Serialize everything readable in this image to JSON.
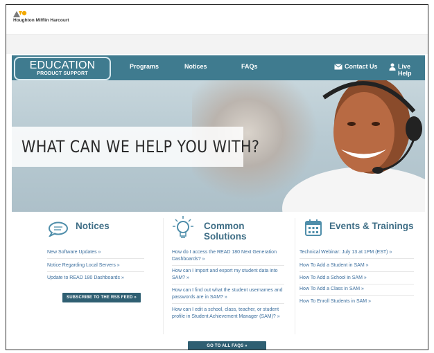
{
  "header": {
    "company": "Houghton Mifflin Harcourt"
  },
  "nav": {
    "brand_title": "EDUCATION",
    "brand_sub": "PRODUCT SUPPORT",
    "items": [
      "Programs",
      "Notices",
      "FAQs"
    ],
    "contact_label": "Contact Us",
    "live_help_label": "Live Help"
  },
  "hero": {
    "headline": "WHAT CAN WE HELP YOU WITH?"
  },
  "notices": {
    "title": "Notices",
    "links": [
      "New Software Updates »",
      "Notice Regarding Local Servers »",
      "Update to READ 180 Dashboards »"
    ],
    "button_label": "SUBSCRIBE TO THE RSS FEED »"
  },
  "solutions": {
    "title": "Common Solutions",
    "links": [
      "How do I access the READ 180 Next Generation Dashboards? »",
      "How can I import and export my student data into SAM? »",
      "How can I find out what the student usernames and passwords are in SAM? »",
      "How can I edit a school, class, teacher, or student profile in Student Achievement Manager (SAM)? »"
    ],
    "button_label": "GO TO ALL FAQS »"
  },
  "events": {
    "title": "Events & Trainings",
    "links": [
      "Technical Webinar: July 13 at 1PM (EST) »",
      "How To Add a Student in SAM »",
      "How To Add a School in SAM »",
      "How To Add a Class in SAM »",
      "How To Enroll Students in SAM »"
    ]
  },
  "colors": {
    "nav_bg": "#3f7b8f",
    "accent_link": "#3b6e9d",
    "button_bg": "#2f5f72",
    "logo_orange": "#f2a900"
  },
  "icons": {
    "notices": "speech-bubble-icon",
    "solutions": "lightbulb-icon",
    "events": "calendar-icon",
    "contact": "envelope-icon",
    "live_help": "person-icon"
  }
}
